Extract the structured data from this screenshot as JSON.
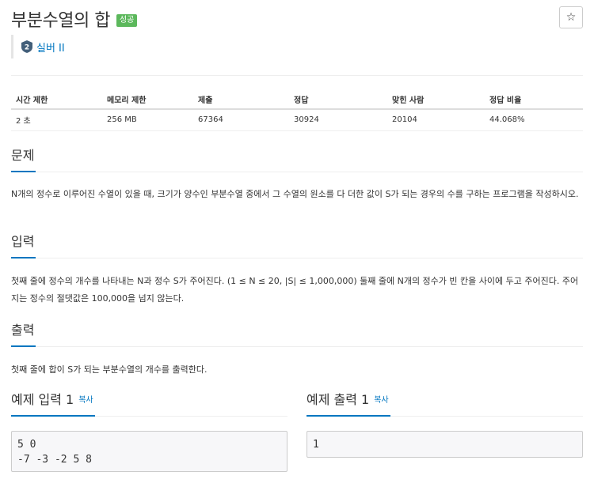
{
  "problem": {
    "title": "부분수열의 합",
    "result_badge": "성공",
    "star_icon": "☆",
    "tier": {
      "icon": "silver-tier-icon",
      "icon_text": "2",
      "label": "실버 II",
      "color": "#435f7a"
    }
  },
  "info_table": {
    "headers": [
      "시간 제한",
      "메모리 제한",
      "제출",
      "정답",
      "맞힌 사람",
      "정답 비율"
    ],
    "row": [
      "2 초",
      "256 MB",
      "67364",
      "30924",
      "20104",
      "44.068%"
    ]
  },
  "sections": {
    "description": {
      "heading": "문제",
      "text": "N개의 정수로 이루어진 수열이 있을 때, 크기가 양수인 부분수열 중에서 그 수열의 원소를 다 더한 값이 S가 되는 경우의 수를 구하는 프로그램을 작성하시오."
    },
    "input": {
      "heading": "입력",
      "text": "첫째 줄에 정수의 개수를 나타내는 N과 정수 S가 주어진다. (1 ≤ N ≤ 20, |S| ≤ 1,000,000) 둘째 줄에 N개의 정수가 빈 칸을 사이에 두고 주어진다. 주어지는 정수의 절댓값은 100,000을 넘지 않는다."
    },
    "output": {
      "heading": "출력",
      "text": "첫째 줄에 합이 S가 되는 부분수열의 개수를 출력한다."
    }
  },
  "samples": {
    "input": {
      "heading": "예제 입력 1",
      "copy_label": "복사",
      "content": "5 0\n-7 -3 -2 5 8"
    },
    "output": {
      "heading": "예제 출력 1",
      "copy_label": "복사",
      "content": "1"
    }
  },
  "colors": {
    "accent": "#0076c0",
    "success": "#5cb85c"
  }
}
